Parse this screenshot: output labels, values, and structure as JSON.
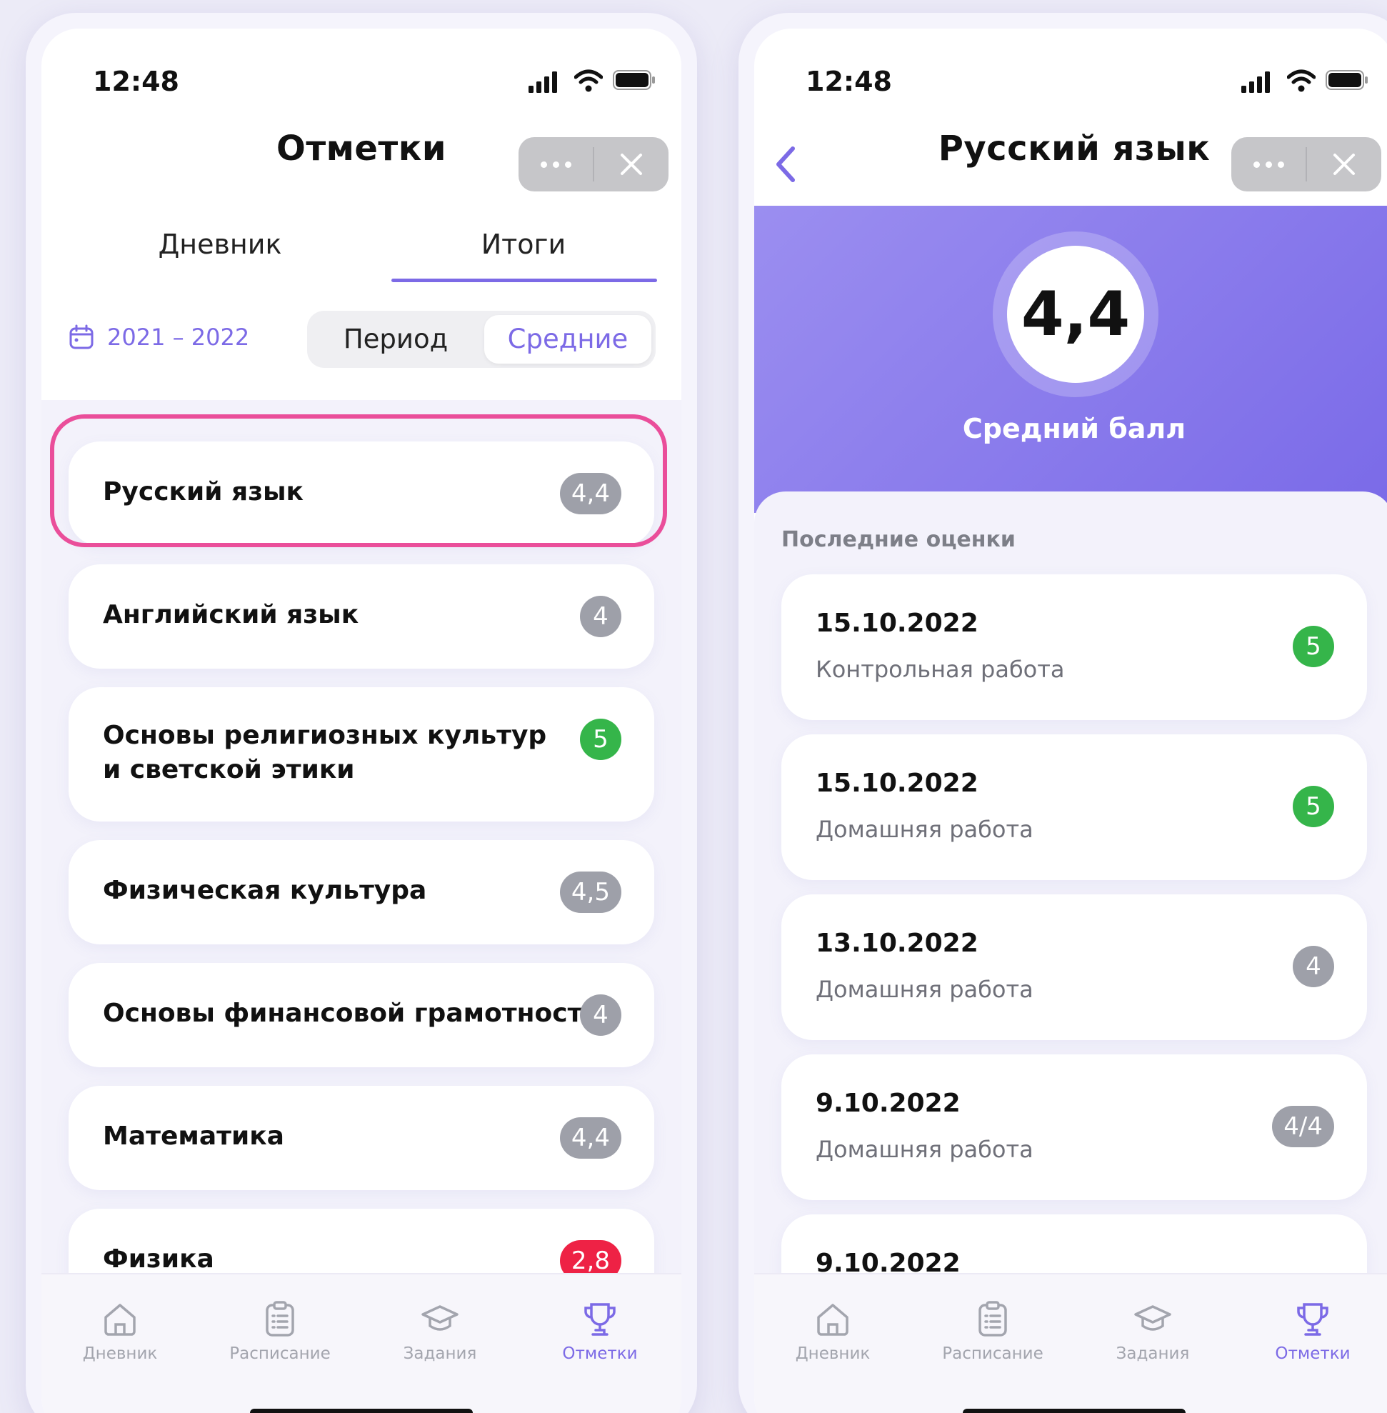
{
  "status": {
    "time": "12:48"
  },
  "left": {
    "title": "Отметки",
    "tabs": [
      "Дневник",
      "Итоги"
    ],
    "year": "2021 – 2022",
    "segment": [
      "Период",
      "Средние"
    ],
    "subjects": [
      {
        "name": "Русский язык",
        "grade": "4,4",
        "color": "grey"
      },
      {
        "name": "Английский язык",
        "grade": "4",
        "color": "grey"
      },
      {
        "name": "Основы религиозных культур",
        "name2": "и светской этики",
        "grade": "5",
        "color": "green"
      },
      {
        "name": "Физическая культура",
        "grade": "4,5",
        "color": "grey"
      },
      {
        "name": "Основы финансовой грамотности",
        "grade": "4",
        "color": "grey"
      },
      {
        "name": "Математика",
        "grade": "4,4",
        "color": "grey"
      },
      {
        "name": "Физика",
        "grade": "2,8",
        "color": "red"
      }
    ]
  },
  "right": {
    "title": "Русский язык",
    "average": "4,4",
    "average_label": "Средний балл",
    "section_title": "Последние оценки",
    "grades": [
      {
        "date": "15.10.2022",
        "type": "Контрольная работа",
        "grade": "5",
        "color": "green"
      },
      {
        "date": "15.10.2022",
        "type": "Домашняя работа",
        "grade": "5",
        "color": "green"
      },
      {
        "date": "13.10.2022",
        "type": "Домашняя работа",
        "grade": "4",
        "color": "grey"
      },
      {
        "date": "9.10.2022",
        "type": "Домашняя работа",
        "grade": "4/4",
        "color": "grey"
      },
      {
        "date": "9.10.2022"
      }
    ]
  },
  "nav": [
    {
      "label": "Дневник",
      "icon": "home-icon"
    },
    {
      "label": "Расписание",
      "icon": "clipboard-icon"
    },
    {
      "label": "Задания",
      "icon": "graduation-cap-icon"
    },
    {
      "label": "Отметки",
      "icon": "trophy-icon",
      "active": true
    }
  ],
  "colors": {
    "accent": "#7c6ae6",
    "highlight": "#ea4e9a",
    "green": "#35b54a",
    "red": "#ee2245",
    "grey": "#9ea0a9"
  }
}
